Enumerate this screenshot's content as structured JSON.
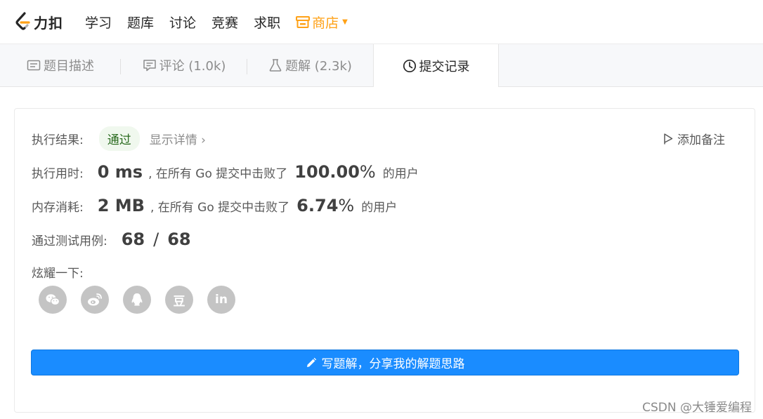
{
  "brand": {
    "logo_text": "力扣",
    "accent": "#ffa116"
  },
  "nav": {
    "items": [
      "学习",
      "题库",
      "讨论",
      "竞赛",
      "求职"
    ],
    "shop_label": "商店"
  },
  "tabs": [
    {
      "label": "题目描述",
      "icon": "document-icon"
    },
    {
      "label": "评论 (1.0k)",
      "icon": "comment-icon"
    },
    {
      "label": "题解 (2.3k)",
      "icon": "flask-icon"
    },
    {
      "label": "提交记录",
      "icon": "clock-icon",
      "active": true
    }
  ],
  "result": {
    "label": "执行结果:",
    "status": "通过",
    "details_link": "显示详情",
    "add_note": "添加备注"
  },
  "runtime": {
    "label": "执行用时:",
    "value": "0 ms",
    "beat_text": ", 在所有 Go 提交中击败了",
    "percent": "100.00",
    "percent_symbol": "%",
    "suffix": "的用户"
  },
  "memory": {
    "label": "内存消耗:",
    "value": "2 MB",
    "beat_text": ", 在所有 Go 提交中击败了",
    "percent": "6.74",
    "percent_symbol": "%",
    "suffix": "的用户"
  },
  "tests": {
    "label": "通过测试用例:",
    "passed": "68",
    "slash": "/",
    "total": "68"
  },
  "share": {
    "label": "炫耀一下:",
    "douban_glyph": "豆",
    "linkedin_glyph": "in"
  },
  "write_button": "写题解，分享我的解题思路",
  "watermark": "CSDN @大锤爱编程",
  "colors": {
    "primary_button": "#1a8cff",
    "pass_badge_bg": "#f0f8ee",
    "pass_badge_text": "#2a6b1f"
  }
}
